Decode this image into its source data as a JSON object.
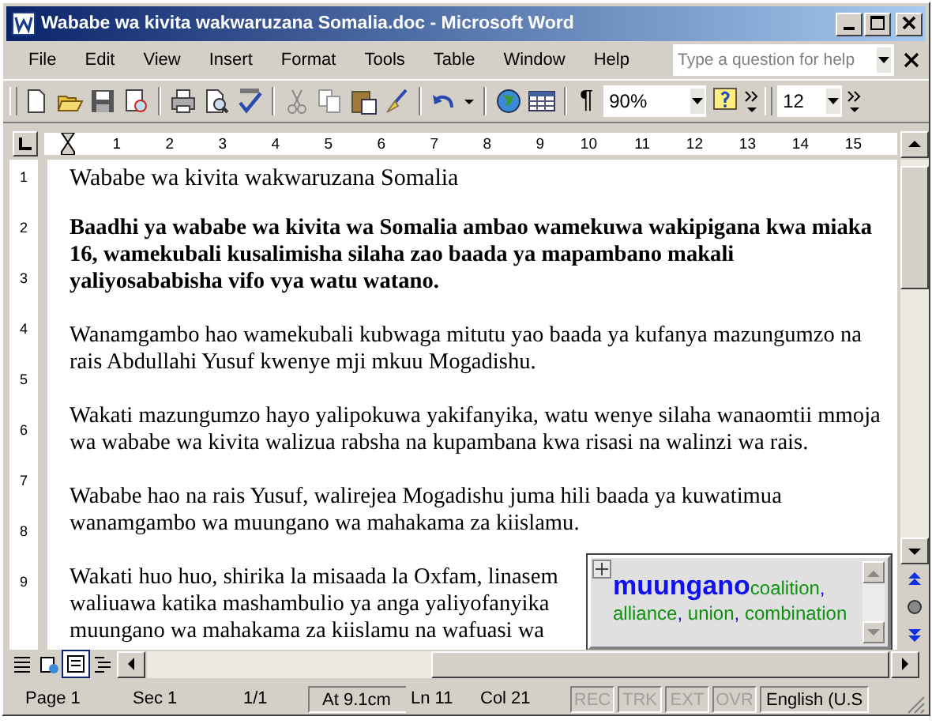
{
  "window": {
    "title": "Wababe wa kivita wakwaruzana Somalia.doc - Microsoft Word"
  },
  "menu": [
    "File",
    "Edit",
    "View",
    "Insert",
    "Format",
    "Tools",
    "Table",
    "Window",
    "Help"
  ],
  "help_box": {
    "placeholder": "Type a question for help"
  },
  "toolbar": {
    "pilcrow": "¶",
    "zoom": "90%",
    "font_size": "12"
  },
  "ruler": {
    "numbers": [
      "1",
      "2",
      "3",
      "4",
      "5",
      "6",
      "7",
      "8",
      "9",
      "10",
      "11",
      "12",
      "13",
      "14",
      "15"
    ]
  },
  "vertical_ruler": {
    "numbers": [
      "1",
      "2",
      "3",
      "4",
      "5",
      "6",
      "7",
      "8",
      "9"
    ]
  },
  "document": {
    "paragraphs": [
      {
        "kind": "title",
        "lines": [
          "Wababe wa kivita wakwaruzana Somalia"
        ]
      },
      {
        "kind": "lead",
        "lines": [
          "Baadhi ya wababe wa kivita wa Somalia ambao wamekuwa wakipigana kwa miaka",
          "16, wamekubali kusalimisha silaha zao baada ya mapambano makali",
          "yaliyosababisha vifo vya watu watano."
        ]
      },
      {
        "kind": "body",
        "lines": [
          "Wanamgambo hao wamekubali kubwaga mitutu yao baada ya kufanya mazungumzo na",
          "rais  Abdullahi  Yusuf kwenye mji mkuu Mogadishu."
        ]
      },
      {
        "kind": "body",
        "lines": [
          "Wakati mazungumzo hayo yalipokuwa yakifanyika, watu wenye silaha wanaomtii mmoja",
          "wa wababe wa kivita walizua rabsha na kupambana kwa risasi na walinzi wa rais."
        ]
      },
      {
        "kind": "body",
        "lines": [
          "Wababe hao na rais  Yusuf, walirejea Mogadishu juma hili baada ya kuwatimua",
          "wanamgambo wa muungano wa mahakama za kiislamu."
        ]
      },
      {
        "kind": "body",
        "lines": [
          "Wakati huo huo, shirika la misaada la Oxfam, linasem",
          "waliuawa katika mashambulio ya anga yaliyofanyika",
          "muungano wa mahakama za kiislamu na wafuasi wa"
        ]
      }
    ]
  },
  "popup": {
    "word": "muungano",
    "translations": [
      "coalition",
      "alliance",
      "union",
      "combination"
    ],
    "separator": ","
  },
  "status_bar": {
    "fields": [
      {
        "text": "Page 1",
        "disabled": false
      },
      {
        "text": "Sec 1",
        "disabled": false
      },
      {
        "text": "1/1",
        "disabled": false
      },
      {
        "text": "At 9.1cm",
        "disabled": false
      },
      {
        "text": "Ln 11",
        "disabled": false
      },
      {
        "text": "Col 21",
        "disabled": false
      },
      {
        "text": "REC",
        "disabled": true
      },
      {
        "text": "TRK",
        "disabled": true
      },
      {
        "text": "EXT",
        "disabled": true
      },
      {
        "text": "OVR",
        "disabled": true
      },
      {
        "text": "English (U.S",
        "disabled": false
      }
    ]
  }
}
